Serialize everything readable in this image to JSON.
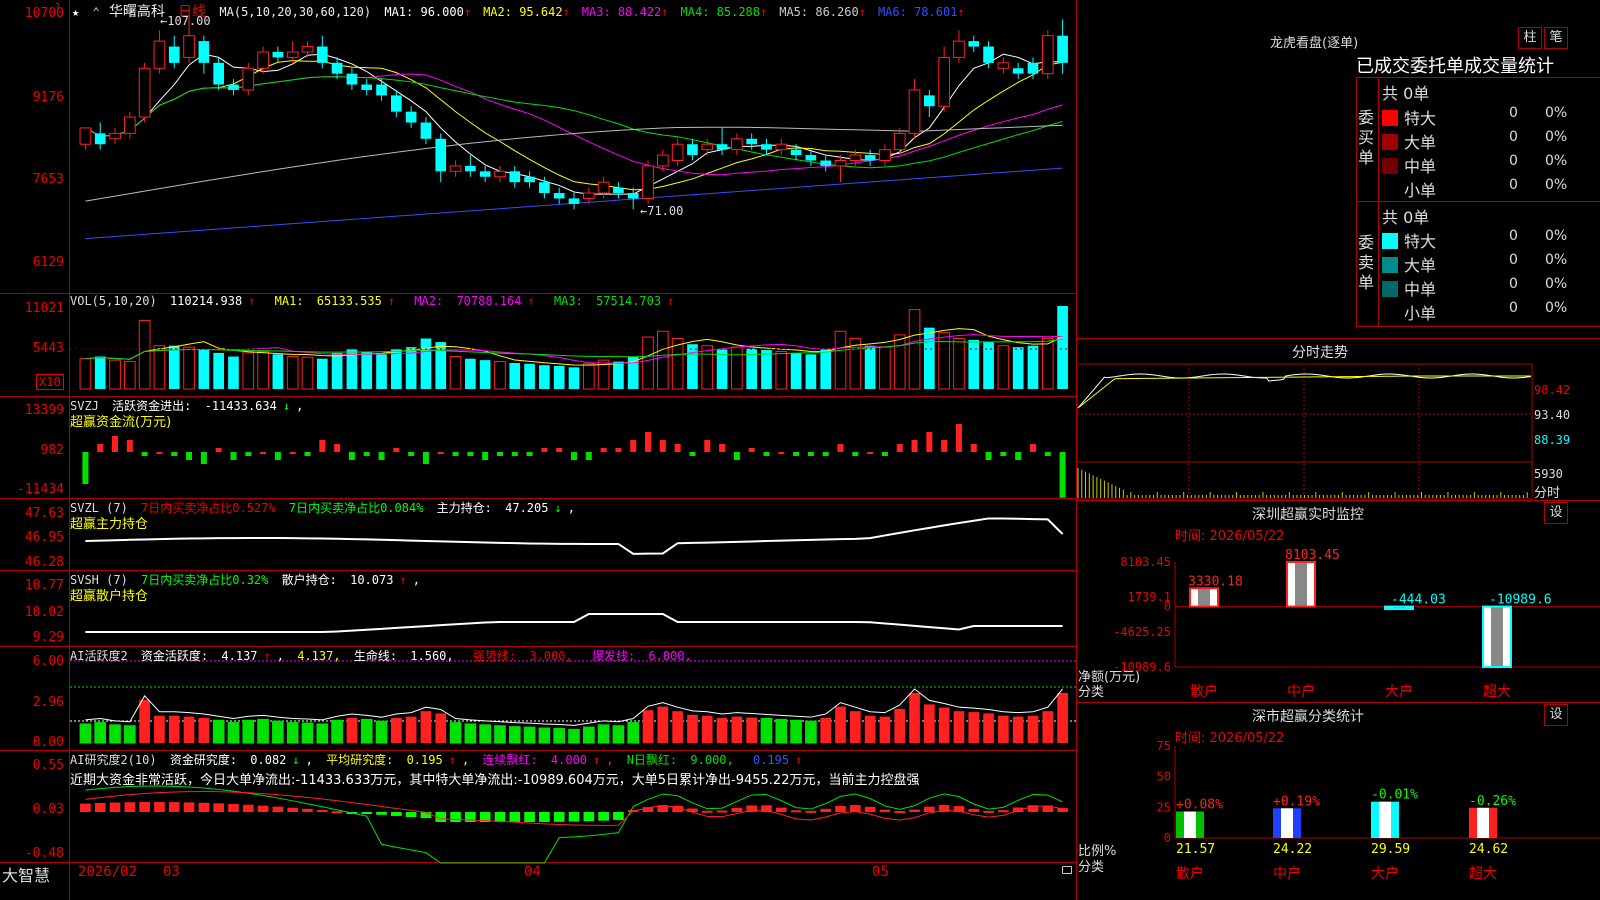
{
  "app": {
    "brand": "大智慧",
    "lock_icon": "lock-icon"
  },
  "main_chart": {
    "stock_name": "华曙高科",
    "period": "日线",
    "indicator": "MA(5,10,20,30,60,120)",
    "ma_values": [
      {
        "label": "MA1:",
        "value": "96.000",
        "color": "#ffffff"
      },
      {
        "label": "MA2:",
        "value": "95.642",
        "color": "#ffff00"
      },
      {
        "label": "MA3:",
        "value": "88.422",
        "color": "#ff00ff"
      },
      {
        "label": "MA4:",
        "value": "85.288",
        "color": "#00e000"
      },
      {
        "label": "MA5:",
        "value": "86.260",
        "color": "#cccccc"
      },
      {
        "label": "MA6:",
        "value": "78.601",
        "color": "#3050ff"
      }
    ],
    "y_ticks": [
      "10700",
      "9176",
      "7653",
      "6129"
    ],
    "high_mark": "107.00",
    "low_mark": "71.00",
    "arrow_up": "↑"
  },
  "x_axis": {
    "labels": [
      "2026/02",
      "03",
      "04",
      "05"
    ]
  },
  "vol_panel": {
    "title": "VOL(5,10,20)",
    "value": "110214.938",
    "ma1": {
      "label": "MA1:",
      "value": "65133.535"
    },
    "ma2": {
      "label": "MA2:",
      "value": "70788.164"
    },
    "ma3": {
      "label": "MA3:",
      "value": "57514.703"
    },
    "y_ticks": [
      "11021",
      "5443"
    ],
    "unit": "X10"
  },
  "svzj_panel": {
    "title": "SVZJ",
    "label": "活跃资金进出:",
    "value": "-11433.634",
    "subtitle": "超赢资金流(万元)",
    "y_ticks": [
      "13399",
      "982",
      "-11434"
    ]
  },
  "svzl_panel": {
    "title": "SVZL (7)",
    "t1": "7日内买卖净占比0.527%",
    "t2": "7日内买卖净占比0.084%",
    "t3_label": "主力持仓:",
    "t3_value": "47.205",
    "subtitle": "超赢主力持仓",
    "y_ticks": [
      "47.63",
      "46.95",
      "46.28"
    ]
  },
  "svsh_panel": {
    "title": "SVSH (7)",
    "t1": "7日内买卖净占比0.32%",
    "t2_label": "散户持仓:",
    "t2_value": "10.073",
    "subtitle": "超赢散户持仓",
    "y_ticks": [
      "10.77",
      "10.02",
      "9.29"
    ]
  },
  "ai_active_panel": {
    "title": "AI活跃度2",
    "label1": "资金活跃度:",
    "val1": "4.137",
    "val2": "4.137,",
    "label3": "生命线:",
    "val3": "1.560,",
    "label4": "强势线:",
    "val4": "3.000,",
    "label5": "爆发线:",
    "val5": "6.000,",
    "y_ticks": [
      "6.00",
      "2.96",
      "0.00"
    ]
  },
  "ai_research_panel": {
    "title": "AI研究度2(10)",
    "label1": "资金研究度:",
    "val1": "0.082",
    "label2": "平均研究度:",
    "val2": "0.195",
    "label3": "连续飘红:",
    "val3": "4.000",
    "label4": "N日飘红:",
    "val4": "9.000,",
    "val5": "0.195",
    "comment": "近期大资金非常活跃，今日大单净流出:-11433.633万元，其中特大单净流出:-10989.604万元，大单5日累计净出-9455.22万元，当前主力控盘强",
    "y_ticks": [
      "0.55",
      "0.03",
      "-0.48"
    ]
  },
  "dragon_panel": {
    "title": "龙虎看盘(逐单)",
    "btn_bar": "柱",
    "btn_stroke": "笔",
    "tabs": [
      "已成交",
      "委托单",
      "成交量统计"
    ],
    "buy_label": "委买单",
    "sell_label": "委卖单",
    "buy_total": "共 0单",
    "sell_total": "共 0单",
    "buy_rows": [
      {
        "name": "特大",
        "count": "0",
        "pct": "0%",
        "color": "#ff0000"
      },
      {
        "name": "大单",
        "count": "0",
        "pct": "0%",
        "color": "#a00000"
      },
      {
        "name": "中单",
        "count": "0",
        "pct": "0%",
        "color": "#700000"
      },
      {
        "name": "小单",
        "count": "0",
        "pct": "0%",
        "color": "#000000"
      }
    ],
    "sell_rows": [
      {
        "name": "特大",
        "count": "0",
        "pct": "0%",
        "color": "#00ffff"
      },
      {
        "name": "大单",
        "count": "0",
        "pct": "0%",
        "color": "#008c8c"
      },
      {
        "name": "中单",
        "count": "0",
        "pct": "0%",
        "color": "#006a6a"
      },
      {
        "name": "小单",
        "count": "0",
        "pct": "0%",
        "color": "#000000"
      }
    ]
  },
  "intraday_panel": {
    "title": "分时走势",
    "y_ticks": [
      "98.42",
      "93.40",
      "88.39"
    ],
    "vol_tick": "5930",
    "vol_unit": "分时"
  },
  "sz_monitor": {
    "title": "深圳超赢实时监控",
    "btn": "设",
    "time_label": "时间: 2026/05/22",
    "y_ticks": [
      "8103.45",
      "1739.1",
      "0",
      "-4625.25",
      "-10989.6"
    ],
    "y_unit": "净额(万元)",
    "x_title": "分类",
    "categories": [
      "散户",
      "中户",
      "大户",
      "超大"
    ],
    "values": [
      3330.18,
      8103.45,
      -444.03,
      -10989.6
    ],
    "value_labels": [
      "3330.18",
      "8103.45",
      "-444.03",
      "-10989.6"
    ],
    "ylim": [
      -10989.6,
      8103.45
    ]
  },
  "sz_stats": {
    "title": "深市超赢分类统计",
    "btn": "设",
    "time_label": "时间: 2026/05/22",
    "y_ticks": [
      "75",
      "50",
      "25",
      "0"
    ],
    "y_unit": "比例%",
    "x_title": "分类",
    "categories": [
      "散户",
      "中户",
      "大户",
      "超大"
    ],
    "values": [
      21.57,
      24.22,
      29.59,
      24.62
    ],
    "value_labels": [
      "21.57",
      "24.22",
      "29.59",
      "24.62"
    ],
    "change_labels": [
      "+0.08%",
      "+0.19%",
      "-0.01%",
      "-0.26%"
    ],
    "colors": [
      "#00c000",
      "#2040ff",
      "#00ffff",
      "#ff2020"
    ],
    "ylim": [
      0,
      75
    ]
  },
  "chart_data": {
    "type": "candlestick",
    "title": "华曙高科 日线",
    "ylim": [
      61.29,
      107.0
    ],
    "candles": [
      [
        83,
        86,
        82,
        85
      ],
      [
        85,
        83,
        82,
        87
      ],
      [
        84,
        85,
        83,
        86
      ],
      [
        85,
        88,
        84,
        89
      ],
      [
        88,
        97,
        87,
        98
      ],
      [
        97,
        102,
        96,
        104
      ],
      [
        101,
        98,
        97,
        103
      ],
      [
        99,
        103,
        98,
        107
      ],
      [
        102,
        98,
        96,
        103
      ],
      [
        98,
        94,
        93,
        99
      ],
      [
        94,
        93,
        92,
        95
      ],
      [
        93,
        97,
        92,
        98
      ],
      [
        97,
        100,
        96,
        101
      ],
      [
        100,
        99,
        98,
        101
      ],
      [
        99,
        100,
        98,
        102
      ],
      [
        100,
        101,
        99,
        102
      ],
      [
        101,
        98,
        97,
        103
      ],
      [
        98,
        96,
        95,
        99
      ],
      [
        96,
        94,
        93,
        97
      ],
      [
        94,
        93,
        92,
        95
      ],
      [
        94,
        92,
        91,
        95
      ],
      [
        92,
        89,
        88,
        93
      ],
      [
        89,
        87,
        86,
        90
      ],
      [
        87,
        84,
        83,
        88
      ],
      [
        84,
        78,
        76,
        85
      ],
      [
        78,
        79,
        77,
        80
      ],
      [
        79,
        78,
        77,
        81
      ],
      [
        78,
        77,
        76,
        79
      ],
      [
        77,
        78,
        76,
        79
      ],
      [
        78,
        76,
        75,
        79
      ],
      [
        77,
        76,
        75,
        78
      ],
      [
        76,
        74,
        73,
        77
      ],
      [
        74,
        73,
        72,
        75
      ],
      [
        73,
        72,
        71,
        74
      ],
      [
        73,
        74,
        72,
        75
      ],
      [
        74,
        76,
        73,
        77
      ],
      [
        75,
        74,
        73,
        76
      ],
      [
        74,
        73,
        71,
        75
      ],
      [
        73,
        79,
        72,
        80
      ],
      [
        79,
        81,
        78,
        82
      ],
      [
        80,
        83,
        79,
        84
      ],
      [
        83,
        81,
        80,
        84
      ],
      [
        82,
        83,
        81,
        84
      ],
      [
        83,
        82,
        81,
        86
      ],
      [
        82,
        84,
        81,
        85
      ],
      [
        84,
        83,
        82,
        85
      ],
      [
        83,
        82,
        81,
        84
      ],
      [
        82,
        83,
        81,
        84
      ],
      [
        82,
        81,
        80,
        83
      ],
      [
        81,
        80,
        79,
        82
      ],
      [
        80,
        79,
        78,
        81
      ],
      [
        79,
        80,
        76,
        81
      ],
      [
        80,
        81,
        79,
        82
      ],
      [
        81,
        80,
        79,
        82
      ],
      [
        80,
        82,
        79,
        83
      ],
      [
        82,
        85,
        81,
        86
      ],
      [
        85,
        93,
        84,
        95
      ],
      [
        92,
        90,
        88,
        93
      ],
      [
        90,
        99,
        89,
        101
      ],
      [
        99,
        102,
        98,
        104
      ],
      [
        102,
        101,
        100,
        103
      ],
      [
        101,
        98,
        97,
        102
      ],
      [
        97,
        98,
        96,
        99
      ],
      [
        97,
        96,
        95,
        98
      ],
      [
        98,
        96,
        95,
        99
      ],
      [
        96,
        103,
        95,
        104
      ],
      [
        103,
        98,
        96,
        106
      ]
    ],
    "volume": [
      42,
      45,
      40,
      38,
      95,
      60,
      60,
      58,
      55,
      50,
      45,
      50,
      52,
      48,
      45,
      44,
      42,
      50,
      55,
      52,
      48,
      55,
      58,
      70,
      65,
      45,
      42,
      40,
      38,
      36,
      35,
      33,
      32,
      30,
      35,
      40,
      38,
      45,
      72,
      80,
      70,
      62,
      60,
      55,
      58,
      56,
      54,
      52,
      50,
      48,
      55,
      80,
      70,
      60,
      58,
      75,
      110,
      85,
      78,
      70,
      68,
      65,
      60,
      58,
      60,
      70,
      115
    ],
    "moneyflow": [
      -8,
      2,
      4,
      3,
      -1,
      0,
      -1,
      -2,
      -3,
      1,
      -2,
      -1,
      0,
      -2,
      0,
      -1,
      3,
      2,
      -2,
      -1,
      -2,
      1,
      -1,
      -3,
      0,
      -1,
      -1,
      -2,
      -1,
      -1,
      -1,
      1,
      1,
      -2,
      -2,
      1,
      1,
      3,
      5,
      3,
      2,
      -1,
      3,
      2,
      -2,
      1,
      -1,
      0,
      -1,
      -1,
      -1,
      2,
      -1,
      0,
      -1,
      2,
      3,
      5,
      3,
      7,
      2,
      -2,
      -1,
      -2,
      2,
      -1,
      -11.43
    ]
  }
}
